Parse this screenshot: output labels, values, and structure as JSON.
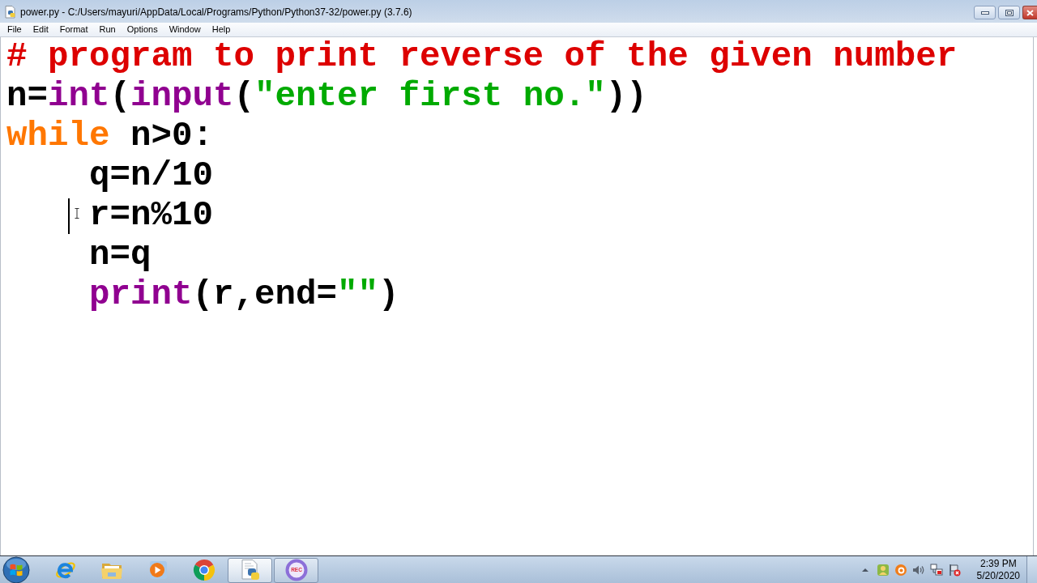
{
  "window": {
    "title": "power.py - C:/Users/mayuri/AppData/Local/Programs/Python/Python37-32/power.py (3.7.6)"
  },
  "menu": [
    "File",
    "Edit",
    "Format",
    "Run",
    "Options",
    "Window",
    "Help"
  ],
  "editor": {
    "lines": [
      {
        "tokens": [
          {
            "kind": "comment",
            "text": "# program to print reverse of the given number"
          }
        ],
        "cursor": false
      },
      {
        "tokens": [
          {
            "kind": "plain",
            "text": "n="
          },
          {
            "kind": "builtin",
            "text": "int"
          },
          {
            "kind": "plain",
            "text": "("
          },
          {
            "kind": "builtin",
            "text": "input"
          },
          {
            "kind": "plain",
            "text": "("
          },
          {
            "kind": "string",
            "text": "\"enter first no.\""
          },
          {
            "kind": "plain",
            "text": "))"
          }
        ],
        "cursor": false
      },
      {
        "tokens": [
          {
            "kind": "keyword",
            "text": "while"
          },
          {
            "kind": "plain",
            "text": " n>0:"
          }
        ],
        "cursor": false,
        "children": [
          {
            "tokens": [
              {
                "kind": "plain",
                "text": "q=n/10"
              }
            ],
            "cursor": false
          },
          {
            "tokens": [
              {
                "kind": "plain",
                "text": "r=n%10"
              }
            ],
            "cursor": true
          },
          {
            "tokens": [
              {
                "kind": "plain",
                "text": "n=q"
              }
            ],
            "cursor": false
          },
          {
            "tokens": [
              {
                "kind": "builtin",
                "text": "print"
              },
              {
                "kind": "plain",
                "text": "(r,end="
              },
              {
                "kind": "string",
                "text": "\"\""
              },
              {
                "kind": "plain",
                "text": ")"
              }
            ],
            "cursor": false
          }
        ]
      }
    ]
  },
  "taskbar": {
    "apps": [
      {
        "kind": "e-swirl",
        "running": false,
        "selected": false
      },
      {
        "kind": "folder",
        "running": false,
        "selected": false
      },
      {
        "kind": "media",
        "running": false,
        "selected": false
      },
      {
        "kind": "round-browser",
        "running": false,
        "selected": false
      },
      {
        "kind": "script-file",
        "running": true,
        "selected": true
      },
      {
        "kind": "recorder",
        "running": true,
        "selected": false,
        "label": "REC"
      }
    ],
    "clock": {
      "time": "2:39 PM",
      "date": "5/20/2020"
    }
  }
}
